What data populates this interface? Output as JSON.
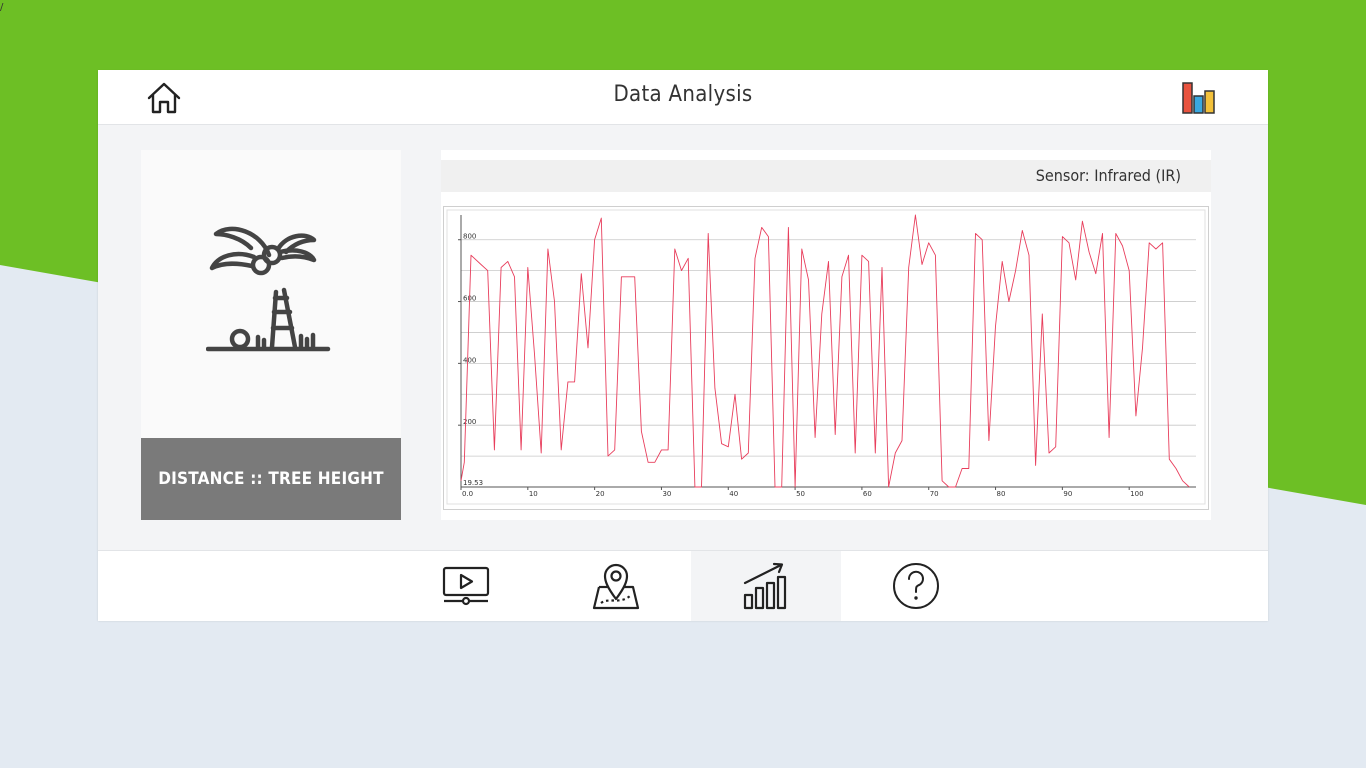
{
  "page": {
    "corner_mark": "/"
  },
  "header": {
    "title": "Data Analysis",
    "home_icon": "home-icon",
    "chart_icon": "bar-chart-icon",
    "chart_icon_colors": [
      "#e8533f",
      "#3aa8e0",
      "#f3c13a"
    ]
  },
  "left_card": {
    "icon": "palm-tree-icon",
    "caption": "DISTANCE :: TREE HEIGHT"
  },
  "sensor": {
    "label": "Sensor: Infrared (IR)"
  },
  "bottom_nav": [
    {
      "name": "video",
      "icon": "video-player-icon",
      "active": false
    },
    {
      "name": "map",
      "icon": "map-pin-icon",
      "active": false
    },
    {
      "name": "analytics",
      "icon": "growth-chart-icon",
      "active": true
    },
    {
      "name": "help",
      "icon": "question-circle-icon",
      "active": false
    }
  ],
  "colors": {
    "line": "#e83e5c",
    "accent_green": "#6dbf25",
    "caption_bg": "#7a7a7a"
  },
  "chart_data": {
    "type": "line",
    "title": "",
    "xlabel": "",
    "ylabel": "",
    "xlim": [
      0,
      110
    ],
    "ylim": [
      0,
      880
    ],
    "ymin_label": "19.53",
    "xticks": [
      0,
      10,
      20,
      30,
      40,
      50,
      60,
      70,
      80,
      90,
      100
    ],
    "xtick_labels": [
      "0.0",
      "10",
      "20",
      "30",
      "40",
      "50",
      "60",
      "70",
      "80",
      "90",
      "100"
    ],
    "yticks": [
      200,
      400,
      600,
      800
    ],
    "grid": true,
    "series": [
      {
        "color": "#e83e5c",
        "points": [
          [
            0,
            20
          ],
          [
            0.5,
            80
          ],
          [
            1.5,
            750
          ],
          [
            3,
            720
          ],
          [
            4,
            700
          ],
          [
            5,
            120
          ],
          [
            6,
            710
          ],
          [
            7,
            730
          ],
          [
            8,
            680
          ],
          [
            9,
            120
          ],
          [
            10,
            710
          ],
          [
            11,
            430
          ],
          [
            12,
            110
          ],
          [
            13,
            770
          ],
          [
            14,
            600
          ],
          [
            15,
            120
          ],
          [
            16,
            340
          ],
          [
            17,
            340
          ],
          [
            18,
            690
          ],
          [
            19,
            450
          ],
          [
            20,
            800
          ],
          [
            21,
            870
          ],
          [
            22,
            100
          ],
          [
            23,
            120
          ],
          [
            24,
            680
          ],
          [
            25,
            680
          ],
          [
            26,
            680
          ],
          [
            27,
            180
          ],
          [
            28,
            80
          ],
          [
            29,
            80
          ],
          [
            30,
            120
          ],
          [
            31,
            120
          ],
          [
            32,
            770
          ],
          [
            33,
            700
          ],
          [
            34,
            740
          ],
          [
            35,
            0
          ],
          [
            36,
            0
          ],
          [
            37,
            820
          ],
          [
            38,
            320
          ],
          [
            39,
            140
          ],
          [
            40,
            130
          ],
          [
            41,
            300
          ],
          [
            42,
            90
          ],
          [
            43,
            110
          ],
          [
            44,
            740
          ],
          [
            45,
            840
          ],
          [
            46,
            810
          ],
          [
            47,
            0
          ],
          [
            48,
            0
          ],
          [
            49,
            840
          ],
          [
            50,
            0
          ],
          [
            51,
            770
          ],
          [
            52,
            670
          ],
          [
            53,
            160
          ],
          [
            54,
            560
          ],
          [
            55,
            730
          ],
          [
            56,
            170
          ],
          [
            57,
            680
          ],
          [
            58,
            750
          ],
          [
            59,
            110
          ],
          [
            60,
            750
          ],
          [
            61,
            730
          ],
          [
            62,
            110
          ],
          [
            63,
            710
          ],
          [
            64,
            0
          ],
          [
            65,
            110
          ],
          [
            66,
            150
          ],
          [
            67,
            710
          ],
          [
            68,
            880
          ],
          [
            69,
            720
          ],
          [
            70,
            790
          ],
          [
            71,
            750
          ],
          [
            72,
            20
          ],
          [
            73,
            0
          ],
          [
            74,
            0
          ],
          [
            75,
            60
          ],
          [
            76,
            60
          ],
          [
            77,
            820
          ],
          [
            78,
            800
          ],
          [
            79,
            150
          ],
          [
            80,
            520
          ],
          [
            81,
            730
          ],
          [
            82,
            600
          ],
          [
            83,
            700
          ],
          [
            84,
            830
          ],
          [
            85,
            750
          ],
          [
            86,
            70
          ],
          [
            87,
            560
          ],
          [
            88,
            110
          ],
          [
            89,
            130
          ],
          [
            90,
            810
          ],
          [
            91,
            790
          ],
          [
            92,
            670
          ],
          [
            93,
            860
          ],
          [
            94,
            760
          ],
          [
            95,
            690
          ],
          [
            96,
            820
          ],
          [
            97,
            160
          ],
          [
            98,
            820
          ],
          [
            99,
            780
          ],
          [
            100,
            700
          ],
          [
            101,
            230
          ],
          [
            102,
            450
          ],
          [
            103,
            790
          ],
          [
            104,
            770
          ],
          [
            105,
            790
          ],
          [
            106,
            90
          ],
          [
            107,
            60
          ],
          [
            108,
            20
          ],
          [
            109,
            0
          ]
        ]
      }
    ]
  }
}
